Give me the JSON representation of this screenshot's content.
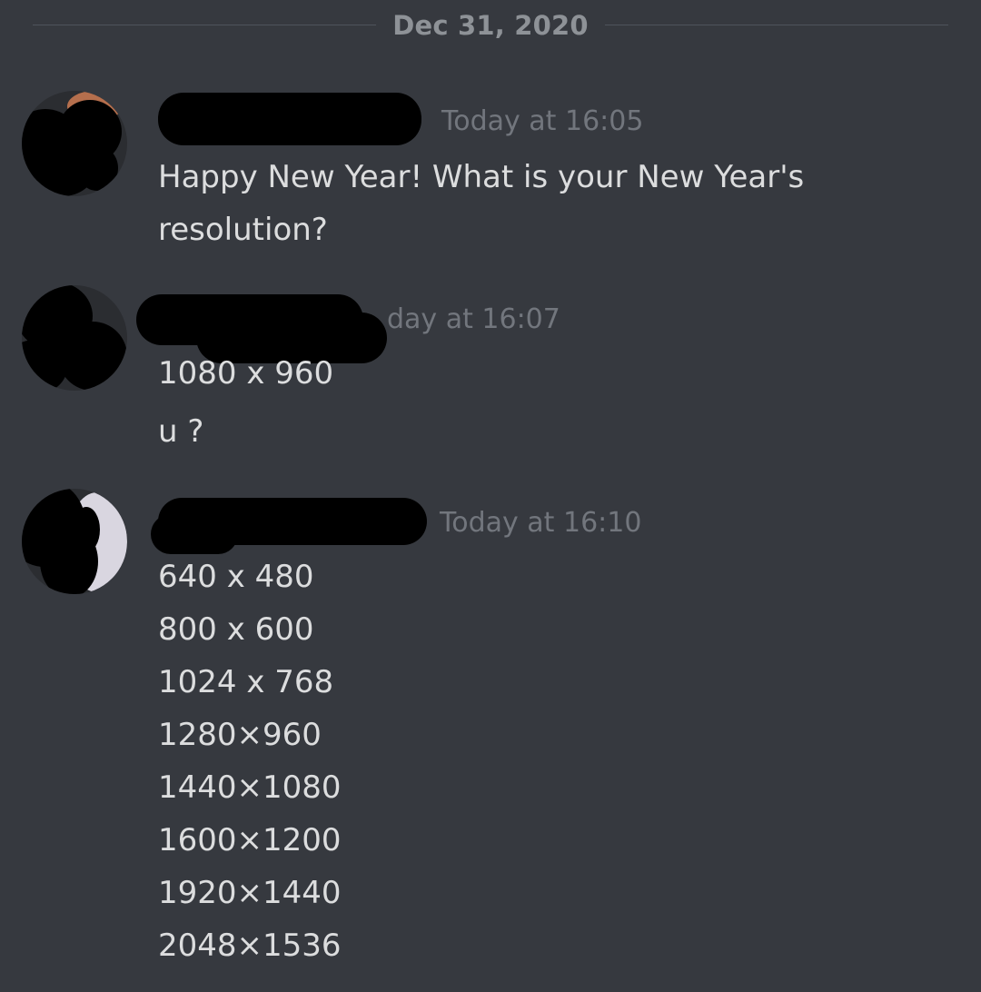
{
  "date_divider": "Dec 31, 2020",
  "messages": [
    {
      "timestamp": "Today at 16:05",
      "lines": [
        "Happy New Year! What is your New Year's",
        "resolution?"
      ]
    },
    {
      "timestamp": "day at 16:07",
      "lines": [
        "1080 x 960",
        "u ?"
      ]
    },
    {
      "timestamp": "Today at 16:10",
      "lines": [
        "640 x 480",
        "800 x 600",
        "1024 x 768",
        "1280×960",
        "1440×1080",
        "1600×1200",
        "1920×1440",
        "2048×1536"
      ]
    }
  ],
  "colors": {
    "background": "#36393f",
    "message_text": "#dcddde",
    "timestamp": "#72767d",
    "divider_text": "#8e9297",
    "divider_line": "#4f545c",
    "redaction": "#000000"
  }
}
